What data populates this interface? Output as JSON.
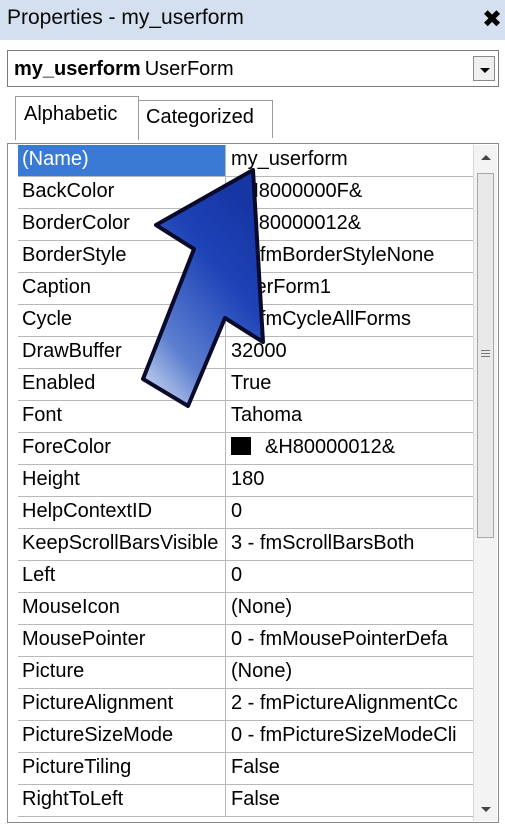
{
  "window": {
    "title": "Properties - my_userform",
    "close_label": "✖"
  },
  "object_selector": {
    "name": "my_userform",
    "type": "UserForm"
  },
  "tabs": [
    {
      "label": "Alphabetic",
      "active": true
    },
    {
      "label": "Categorized",
      "active": false
    }
  ],
  "properties": [
    {
      "name": "(Name)",
      "value": "my_userform"
    },
    {
      "name": "BackColor",
      "value": "&H8000000F&"
    },
    {
      "name": "BorderColor",
      "value": "&H80000012&"
    },
    {
      "name": "BorderStyle",
      "value": "0 - fmBorderStyleNone"
    },
    {
      "name": "Caption",
      "value": "UserForm1"
    },
    {
      "name": "Cycle",
      "value": "0 - fmCycleAllForms"
    },
    {
      "name": "DrawBuffer",
      "value": "32000"
    },
    {
      "name": "Enabled",
      "value": "True"
    },
    {
      "name": "Font",
      "value": "Tahoma"
    },
    {
      "name": "ForeColor",
      "value": "&H80000012&"
    },
    {
      "name": "Height",
      "value": "180"
    },
    {
      "name": "HelpContextID",
      "value": "0"
    },
    {
      "name": "KeepScrollBarsVisible",
      "value": "3 - fmScrollBarsBoth"
    },
    {
      "name": "Left",
      "value": "0"
    },
    {
      "name": "MouseIcon",
      "value": "(None)"
    },
    {
      "name": "MousePointer",
      "value": "0 - fmMousePointerDefa"
    },
    {
      "name": "Picture",
      "value": "(None)"
    },
    {
      "name": "PictureAlignment",
      "value": "2 - fmPictureAlignmentCc"
    },
    {
      "name": "PictureSizeMode",
      "value": "0 - fmPictureSizeModeCli"
    },
    {
      "name": "PictureTiling",
      "value": "False"
    },
    {
      "name": "RightToLeft",
      "value": "False"
    }
  ],
  "colors": {
    "title_bar": "#d4dfef",
    "selected_row": "#3b7ad4",
    "arrow_fill": "#1a3fae",
    "arrow_outline": "#0a0a2a"
  },
  "icons": {
    "close": "close-icon",
    "dropdown": "chevron-down-icon",
    "annotation": "arrow-icon"
  }
}
